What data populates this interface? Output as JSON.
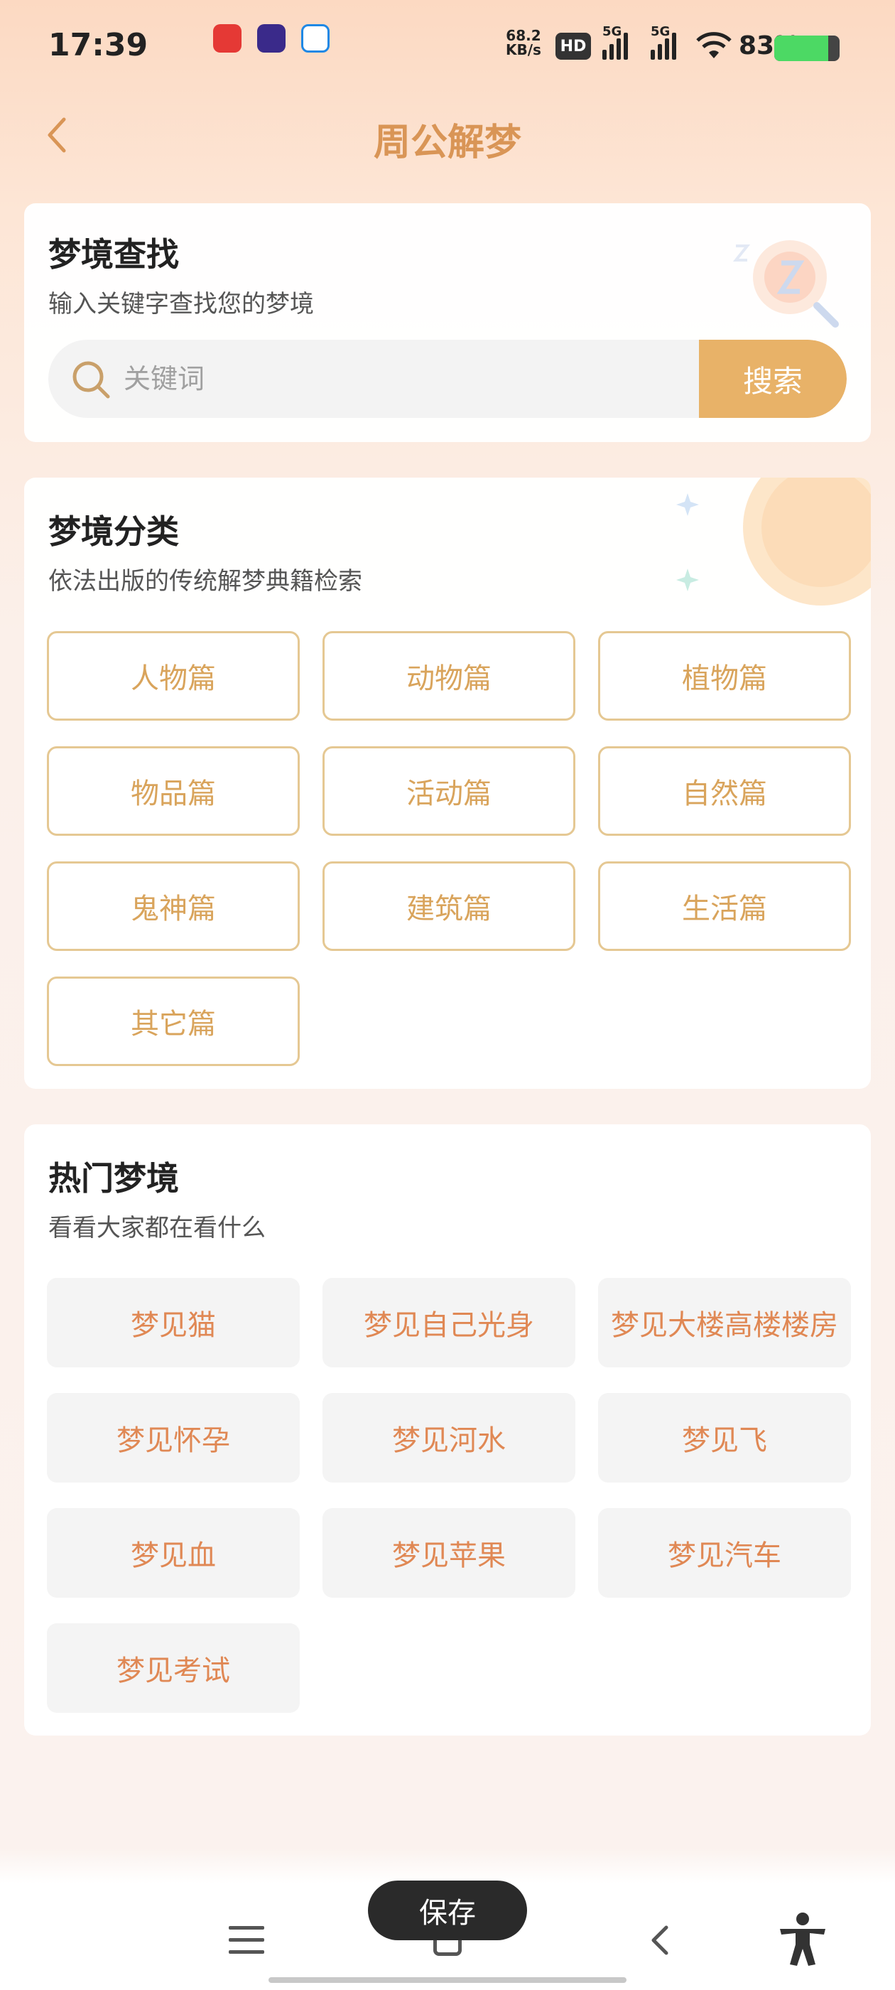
{
  "status_bar": {
    "time": "17:39",
    "net_speed": "68.2",
    "net_unit": "KB/s",
    "hd_badge": "HD",
    "signal1": "5G",
    "signal2": "5G",
    "battery": "83%",
    "battery_level": 0.83
  },
  "header": {
    "title": "周公解梦"
  },
  "search_card": {
    "title": "梦境查找",
    "subtitle": "输入关键字查找您的梦境",
    "placeholder": "关键词",
    "button": "搜索"
  },
  "category_card": {
    "title": "梦境分类",
    "subtitle": "依法出版的传统解梦典籍检索",
    "items": [
      "人物篇",
      "动物篇",
      "植物篇",
      "物品篇",
      "活动篇",
      "自然篇",
      "鬼神篇",
      "建筑篇",
      "生活篇",
      "其它篇"
    ]
  },
  "hot_card": {
    "title": "热门梦境",
    "subtitle": "看看大家都在看什么",
    "items": [
      "梦见猫",
      "梦见自己光身",
      "梦见大楼高楼楼房",
      "梦见怀孕",
      "梦见河水",
      "梦见飞",
      "梦见血",
      "梦见苹果",
      "梦见汽车",
      "梦见考试"
    ]
  },
  "toast": {
    "label": "保存"
  },
  "colors": {
    "accent": "#e8b268",
    "title": "#d99556",
    "category_text": "#d9a45c",
    "hot_text": "#e08854"
  }
}
